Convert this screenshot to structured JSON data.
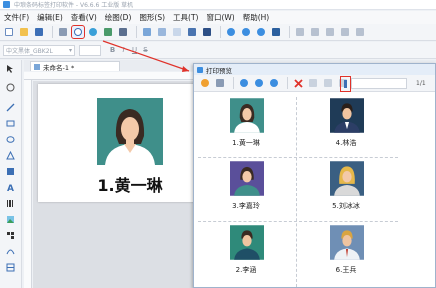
{
  "window": {
    "title": "中琅条码标签打印软件 - V6.6.6 工业版 草机"
  },
  "menu": [
    "文件(F)",
    "编辑(E)",
    "查看(V)",
    "绘图(D)",
    "图形(S)",
    "工具(T)",
    "窗口(W)",
    "帮助(H)"
  ],
  "toolbar": {
    "icons": [
      "new-icon",
      "open-icon",
      "save-icon",
      "print-icon",
      "print-preview-icon",
      "database-icon",
      "settings-icon",
      "grid-icon"
    ],
    "highlighted": "print-preview-icon",
    "highlight_color": "#e0322a"
  },
  "format_bar": {
    "font": "中文黑体_GBK2L",
    "buttons": [
      "B",
      "I",
      "U",
      "S"
    ]
  },
  "document": {
    "tab_label": "未命名-1 *"
  },
  "label": {
    "name": "1.黄一琳"
  },
  "preview": {
    "title": "打印预览",
    "page_value": "",
    "page_count": "1/1",
    "cards": [
      {
        "name": "1.黄一琳"
      },
      {
        "name": "4.林浩"
      },
      {
        "name": "3.李嘉玲"
      },
      {
        "name": "5.刘冰冰"
      },
      {
        "name": "2.李涵"
      },
      {
        "name": "6.王兵"
      }
    ]
  },
  "colors": {
    "accent": "#3c8ee0",
    "highlight": "#e0322a"
  }
}
